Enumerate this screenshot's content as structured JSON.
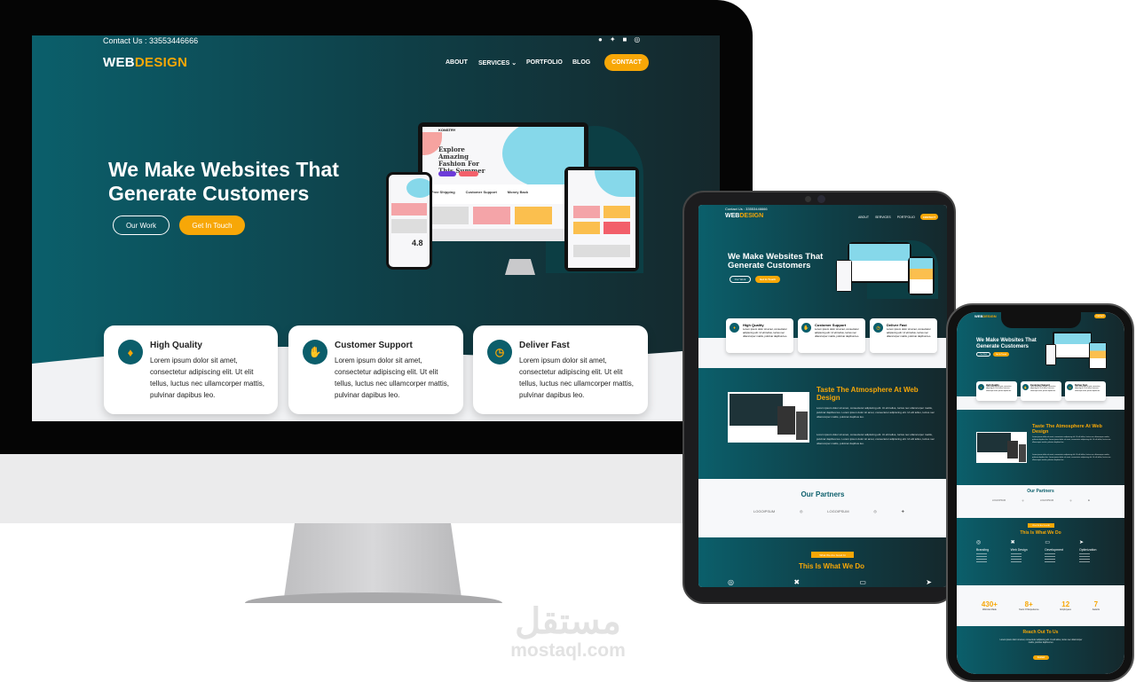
{
  "colors": {
    "primary": "#0b5e6b",
    "accent": "#f7a707",
    "dark": "#15282c"
  },
  "site": {
    "contact": "Contact Us : 33553446666",
    "logo_a": "WEB",
    "logo_b": "DESIGN",
    "socials": [
      "facebook-icon",
      "twitter-icon",
      "instagram-icon",
      "dribbble-icon"
    ],
    "nav": {
      "about": "ABOUT",
      "services": "SERVICES",
      "portfolio": "PORTFOLIO",
      "blog": "BLOG",
      "contact": "CONTACT"
    },
    "hero": {
      "line1": "We Make Websites That",
      "line2": "Generate Customers",
      "btn_work": "Our Work",
      "btn_touch": "Get In Touch"
    },
    "mockup": {
      "brand": "KONSTRY",
      "headline": "Explore Amazing Fashion For This Summer",
      "feat1": "Free Shipping",
      "feat2": "Customer Support",
      "feat3": "Money Back",
      "rating": "4.8"
    },
    "cards": [
      {
        "title": "High Quality",
        "icon": "lightbulb-icon",
        "text": "Lorem ipsum dolor sit amet, consectetur adipiscing elit. Ut elit tellus, luctus nec ullamcorper mattis, pulvinar dapibus leo."
      },
      {
        "title": "Customer Support",
        "icon": "handshake-icon",
        "text": "Lorem ipsum dolor sit amet, consectetur adipiscing elit. Ut elit tellus, luctus nec ullamcorper mattis, pulvinar dapibus leo."
      },
      {
        "title": "Deliver Fast",
        "icon": "clock-icon",
        "text": "Lorem ipsum dolor sit amet, consectetur adipiscing elit. Ut elit tellus, luctus nec ullamcorper mattis, pulvinar dapibus leo."
      }
    ],
    "taste": {
      "title": "Taste The Atmosphere At Web Design",
      "p1": "Lorem ipsum dolor sit amet, consectetur adipiscing elit. Ut elit tellus, luctus nec ullamcorper mattis, pulvinar dapibus leo. Lorem ipsum dolor sit amet, consectetur adipiscing elit. Ut elit tellus, luctus nec ullamcorper mattis, pulvinar dapibus leo.",
      "p2": "Lorem ipsum dolor sit amet, consectetur adipiscing elit. Ut elit tellus, luctus nec ullamcorper mattis, pulvinar dapibus leo. Lorem ipsum dolor sit amet, consectetur adipiscing elit. Ut elit tellus, luctus nec ullamcorper mattis, pulvinar dapibus leo."
    },
    "partners": {
      "title": "Our Partners",
      "logo": "LOGOIPSUM"
    },
    "services": {
      "badge": "What We Are Good At",
      "title": "This Is What We Do",
      "items": [
        "Branding",
        "Web Design",
        "Development",
        "Optimization"
      ]
    },
    "stats": [
      {
        "value": "430+",
        "label": "Website Made"
      },
      {
        "value": "8+",
        "label": "Years Of Experience"
      },
      {
        "value": "12",
        "label": "Employees"
      },
      {
        "value": "7",
        "label": "Awards"
      }
    ],
    "reach": {
      "title": "Reach Out To Us",
      "text": "Lorem ipsum dolor sit amet, consectetur adipiscing elit. Ut elit tellus, luctus nec ullamcorper mattis, pulvinar dapibus leo.",
      "btn": "Contact"
    }
  },
  "watermark": {
    "arabic": "مستقل",
    "latin": "mostaql.com"
  }
}
